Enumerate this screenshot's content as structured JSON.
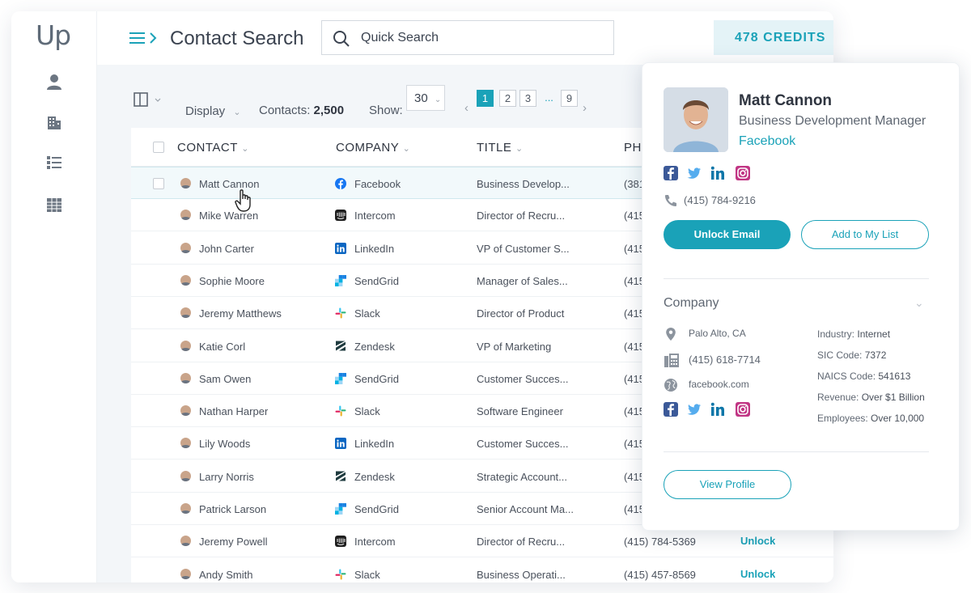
{
  "brand": {
    "logo": "Up",
    "accent": "#1aa2b8"
  },
  "topbar": {
    "title": "Contact Search",
    "search_placeholder": "Quick Search",
    "credits": "478 CREDITS"
  },
  "rail": [
    "person-icon",
    "building-icon",
    "list-icon",
    "grid-icon"
  ],
  "toolbar": {
    "display_label": "Display",
    "contacts_label": "Contacts:",
    "contacts_count": "2,500",
    "show_label": "Show:",
    "show_value": "30",
    "pages": [
      "1",
      "2",
      "3",
      "...",
      "9"
    ],
    "current_page": "1"
  },
  "table": {
    "columns": [
      "CONTACT",
      "COMPANY",
      "TITLE",
      "PH"
    ],
    "rows": [
      {
        "name": "Matt Cannon",
        "company": "Facebook",
        "title": "Business Develop...",
        "phone": "(381",
        "action": ""
      },
      {
        "name": "Mike Warren",
        "company": "Intercom",
        "title": "Director of Recru...",
        "phone": "(415",
        "action": ""
      },
      {
        "name": "John Carter",
        "company": "LinkedIn",
        "title": "VP of Customer S...",
        "phone": "(415",
        "action": ""
      },
      {
        "name": "Sophie Moore",
        "company": "SendGrid",
        "title": "Manager of Sales...",
        "phone": "(415",
        "action": ""
      },
      {
        "name": "Jeremy Matthews",
        "company": "Slack",
        "title": "Director of Product",
        "phone": "(415",
        "action": ""
      },
      {
        "name": "Katie Corl",
        "company": "Zendesk",
        "title": "VP of Marketing",
        "phone": "(415",
        "action": ""
      },
      {
        "name": "Sam Owen",
        "company": "SendGrid",
        "title": "Customer Succes...",
        "phone": "(415",
        "action": ""
      },
      {
        "name": "Nathan Harper",
        "company": "Slack",
        "title": "Software Engineer",
        "phone": "(415",
        "action": ""
      },
      {
        "name": "Lily Woods",
        "company": "LinkedIn",
        "title": "Customer Succes...",
        "phone": "(415",
        "action": ""
      },
      {
        "name": "Larry Norris",
        "company": "Zendesk",
        "title": "Strategic Account...",
        "phone": "(415",
        "action": ""
      },
      {
        "name": "Patrick Larson",
        "company": "SendGrid",
        "title": "Senior Account Ma...",
        "phone": "(415",
        "action": ""
      },
      {
        "name": "Jeremy Powell",
        "company": "Intercom",
        "title": "Director of Recru...",
        "phone": "(415) 784-5369",
        "action": "Unlock"
      },
      {
        "name": "Andy Smith",
        "company": "Slack",
        "title": "Business Operati...",
        "phone": "(415) 457-8569",
        "action": "Unlock"
      }
    ]
  },
  "panel": {
    "name": "Matt Cannon",
    "title": "Business Development Manager",
    "company": "Facebook",
    "phone": "(415) 784-9216",
    "unlock_email": "Unlock Email",
    "add_to_list": "Add to My List",
    "company_section": "Company",
    "location": "Palo Alto, CA",
    "company_phone": "(415) 618-7714",
    "website": "facebook.com",
    "details": [
      {
        "label": "Industry:",
        "value": "Internet"
      },
      {
        "label": "SIC Code:",
        "value": "7372"
      },
      {
        "label": "NAICS Code:",
        "value": "541613"
      },
      {
        "label": "Revenue:",
        "value": "Over $1 Billion"
      },
      {
        "label": "Employees:",
        "value": "Over 10,000"
      }
    ],
    "view_profile": "View Profile"
  }
}
